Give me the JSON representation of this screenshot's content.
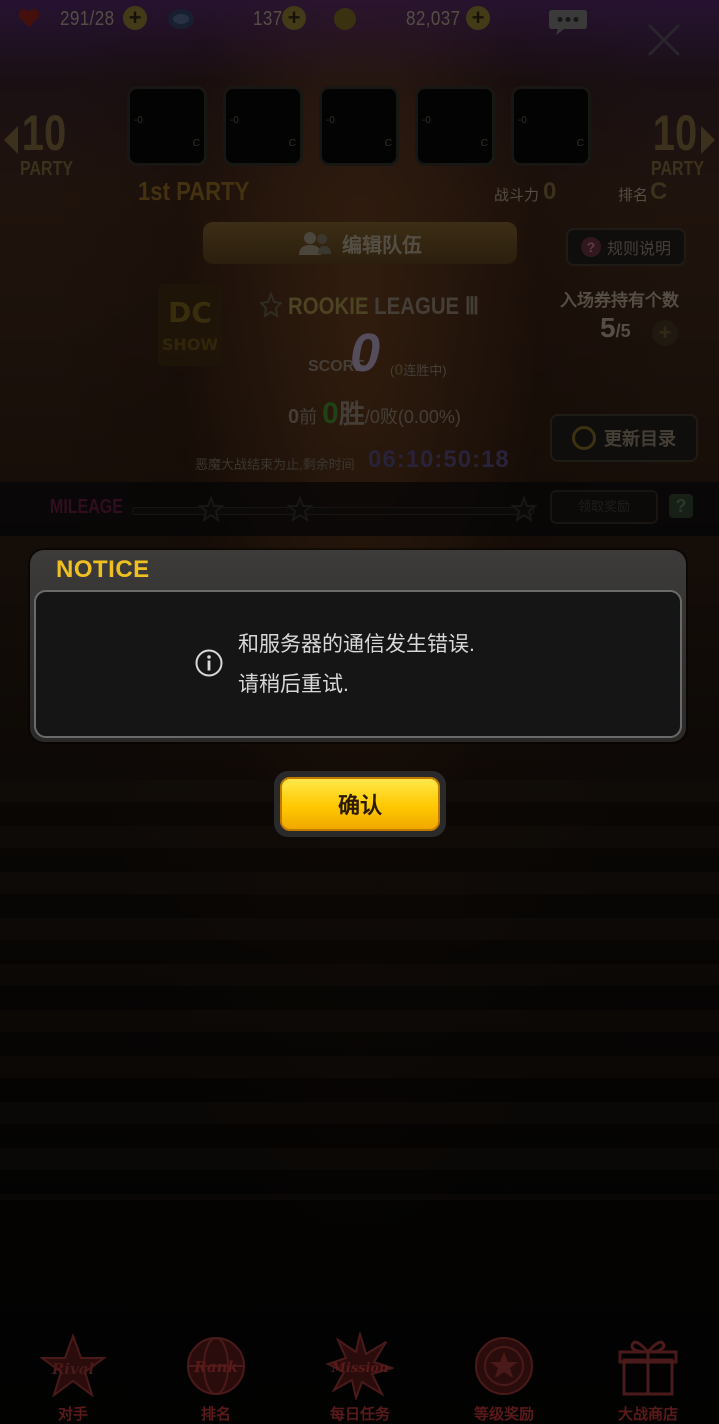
{
  "topbar": {
    "stamina": "291/28",
    "tickets": "137",
    "gold": "82,037"
  },
  "party": {
    "left_num": "10",
    "left_label": "PARTY",
    "right_num": "10",
    "right_label": "PARTY",
    "slots": [
      {
        "lv": "-0",
        "cls": "C"
      },
      {
        "lv": "-0",
        "cls": "C"
      },
      {
        "lv": "-0",
        "cls": "C"
      },
      {
        "lv": "-0",
        "cls": "C"
      },
      {
        "lv": "-0",
        "cls": "C"
      }
    ],
    "name": "1st PARTY",
    "power_label": "战斗力",
    "power_value": "0",
    "rank_label": "排名",
    "rank_value": "C"
  },
  "buttons": {
    "edit_team": "编辑队伍",
    "rules": "规则说明",
    "refresh": "更新目录",
    "claim": "领取奖励"
  },
  "league": {
    "rank_word": "ROOKIE",
    "league_word": "LEAGUE Ⅲ",
    "score_label": "SCORE",
    "score_value": "0",
    "streak_open": "(",
    "streak_num": "0",
    "streak_text": "连胜中)",
    "rank_num": "0",
    "rank_suffix": "前",
    "wins": "0",
    "wins_label": "胜",
    "losses": "/0败(0.00%)",
    "tickets_label": "入场券持有个数",
    "tickets_have": "5",
    "tickets_max": "/5",
    "timer_label": "恶魔大战结束为止,剩余时间",
    "timer_value": "06:10:50:18"
  },
  "mileage": {
    "label": "MILEAGE",
    "stars": 3
  },
  "notice": {
    "title": "NOTICE",
    "line1": "和服务器的通信发生错误.",
    "line2": "请稍后重试.",
    "confirm": "确认"
  },
  "nav": [
    {
      "label": "对手",
      "icon": "rival-icon"
    },
    {
      "label": "排名",
      "icon": "rank-globe-icon"
    },
    {
      "label": "每日任务",
      "icon": "mission-icon"
    },
    {
      "label": "等级奖励",
      "icon": "level-reward-icon"
    },
    {
      "label": "大战商店",
      "icon": "gift-icon"
    }
  ],
  "colors": {
    "notice_title": "#f0c020",
    "confirm_button": "#ffc800",
    "nav_label": "#5a1a1a"
  }
}
